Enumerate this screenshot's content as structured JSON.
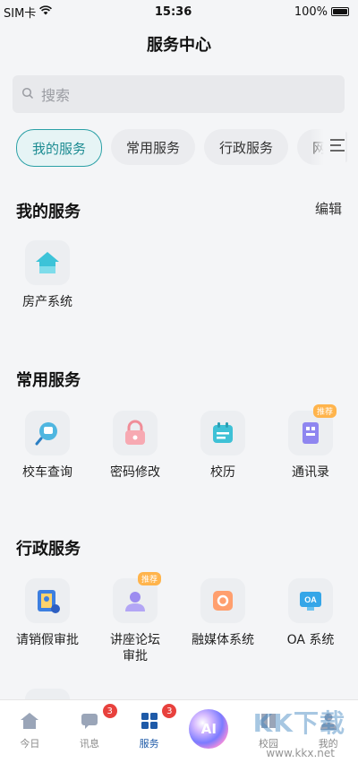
{
  "status_bar": {
    "carrier": "SIM卡",
    "time": "15:36",
    "battery": "100%"
  },
  "header": {
    "title": "服务中心"
  },
  "search": {
    "placeholder": "搜索"
  },
  "tabs": [
    {
      "label": "我的服务",
      "active": true
    },
    {
      "label": "常用服务",
      "active": false
    },
    {
      "label": "行政服务",
      "active": false
    },
    {
      "label": "网络",
      "active": false
    }
  ],
  "sections": {
    "my": {
      "title": "我的服务",
      "edit_label": "编辑",
      "items": [
        {
          "label": "房产系统",
          "icon": "house-icon"
        }
      ]
    },
    "common": {
      "title": "常用服务",
      "items": [
        {
          "label": "校车查询",
          "icon": "bus-search-icon"
        },
        {
          "label": "密码修改",
          "icon": "lock-icon"
        },
        {
          "label": "校历",
          "icon": "calendar-icon"
        },
        {
          "label": "通讯录",
          "icon": "contacts-icon",
          "badge": "推荐"
        }
      ]
    },
    "admin": {
      "title": "行政服务",
      "items": [
        {
          "label": "请销假审批",
          "icon": "leave-approval-icon"
        },
        {
          "label": "讲座论坛审批",
          "icon": "lecture-icon",
          "badge": "推荐"
        },
        {
          "label": "融媒体系统",
          "icon": "media-icon"
        },
        {
          "label": "OA 系统",
          "icon": "oa-icon",
          "icon_text": "OA"
        }
      ]
    }
  },
  "tabbar": [
    {
      "label": "今日",
      "icon": "home-icon"
    },
    {
      "label": "讯息",
      "icon": "message-icon",
      "badge": "3"
    },
    {
      "label": "服务",
      "icon": "grid-icon",
      "badge": "3",
      "active": true
    },
    {
      "label": "",
      "icon": "ai-icon",
      "icon_text": "AI"
    },
    {
      "label": "校园",
      "icon": "campus-icon"
    },
    {
      "label": "我的",
      "icon": "user-icon"
    }
  ],
  "watermark": {
    "brand": "KK下载",
    "url": "www.kkx.net"
  },
  "colors": {
    "accent": "#2aa0a6",
    "active_tab": "#1e5aa8",
    "badge": "#e8413d",
    "recommend": "#ffb44c"
  }
}
